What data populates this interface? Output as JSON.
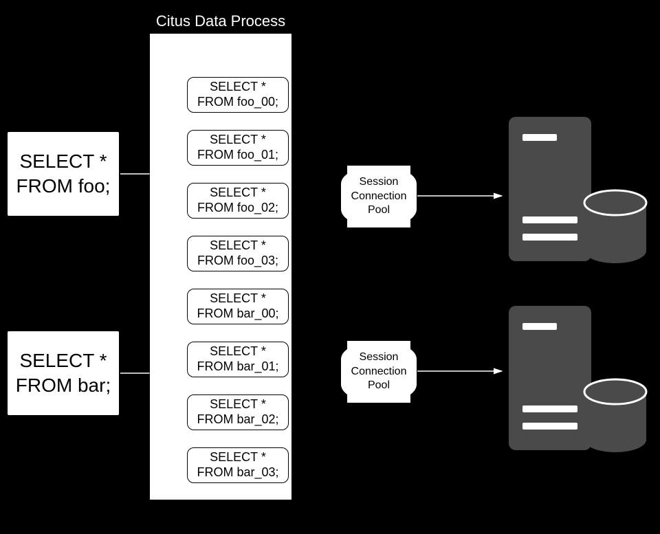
{
  "inputs": {
    "foo": "SELECT *\nFROM foo;",
    "bar": "SELECT *\nFROM bar;"
  },
  "process_label": "Citus Data Process",
  "shards": {
    "foo": [
      "SELECT *\nFROM foo_00;",
      "SELECT *\nFROM foo_01;",
      "SELECT *\nFROM foo_02;",
      "SELECT *\nFROM foo_03;"
    ],
    "bar": [
      "SELECT *\nFROM bar_00;",
      "SELECT *\nFROM bar_01;",
      "SELECT *\nFROM bar_02;",
      "SELECT *\nFROM bar_03;"
    ]
  },
  "pool_label": "Session\nConnection\nPool",
  "icons": {
    "server_color": "#4a4a4a"
  }
}
